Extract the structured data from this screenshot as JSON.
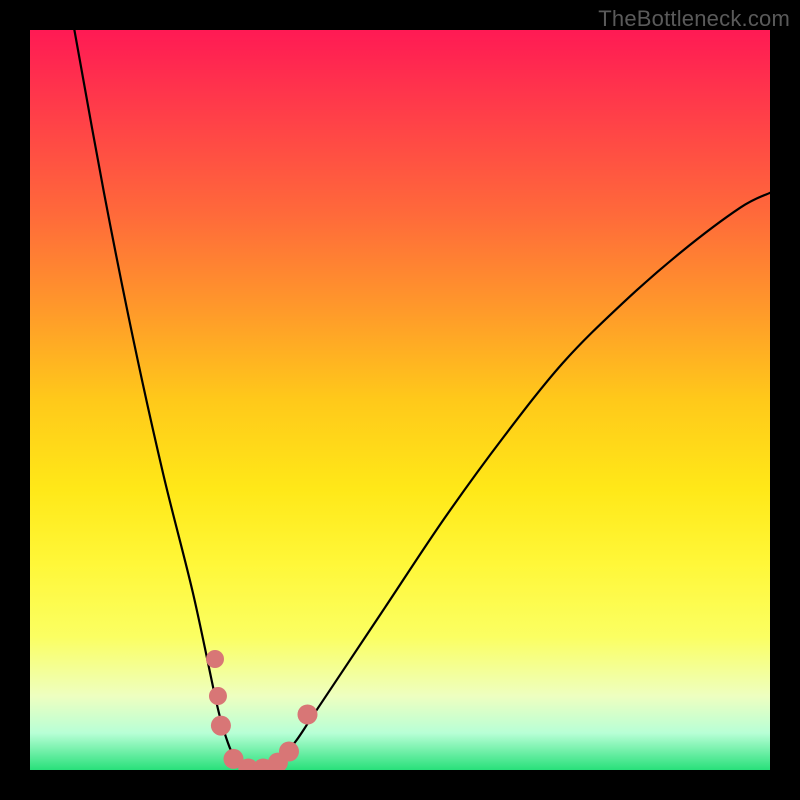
{
  "watermark": "TheBottleneck.com",
  "chart_data": {
    "type": "line",
    "title": "",
    "xlabel": "",
    "ylabel": "",
    "xlim": [
      0,
      100
    ],
    "ylim": [
      0,
      100
    ],
    "grid": false,
    "legend": false,
    "annotations": [],
    "series": [
      {
        "name": "bottleneck-curve",
        "color": "#000000",
        "x": [
          6,
          10,
          14,
          18,
          22,
          25,
          26,
          27,
          28,
          29,
          30,
          31,
          32,
          33,
          34,
          36,
          38,
          42,
          48,
          56,
          64,
          72,
          80,
          88,
          96,
          100
        ],
        "y": [
          100,
          78,
          58,
          40,
          24,
          10,
          6,
          3,
          1,
          0,
          0,
          0,
          0,
          0.5,
          1.5,
          4,
          7,
          13,
          22,
          34,
          45,
          55,
          63,
          70,
          76,
          78
        ]
      }
    ],
    "points": [
      {
        "name": "marker",
        "x": 25.0,
        "y": 15,
        "r": 9
      },
      {
        "name": "marker",
        "x": 25.4,
        "y": 10,
        "r": 9
      },
      {
        "name": "marker",
        "x": 25.8,
        "y": 6,
        "r": 10
      },
      {
        "name": "marker",
        "x": 27.5,
        "y": 1.5,
        "r": 10
      },
      {
        "name": "marker",
        "x": 29.5,
        "y": 0.2,
        "r": 10
      },
      {
        "name": "marker",
        "x": 31.5,
        "y": 0.2,
        "r": 10
      },
      {
        "name": "marker",
        "x": 33.5,
        "y": 1.0,
        "r": 10
      },
      {
        "name": "marker",
        "x": 35.0,
        "y": 2.5,
        "r": 10
      },
      {
        "name": "marker",
        "x": 37.5,
        "y": 7.5,
        "r": 10
      }
    ],
    "gradient_stops": [
      {
        "pos": 0,
        "color": "#ff1a54"
      },
      {
        "pos": 50,
        "color": "#ffc91a"
      },
      {
        "pos": 82,
        "color": "#fbff62"
      },
      {
        "pos": 100,
        "color": "#28e07a"
      }
    ]
  }
}
